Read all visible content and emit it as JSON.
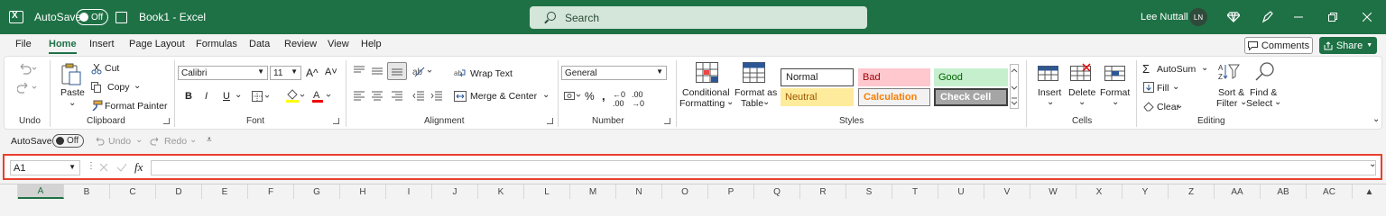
{
  "titlebar": {
    "autosave_label": "AutoSave",
    "autosave_state": "Off",
    "doc_title": "Book1  -  Excel",
    "search_placeholder": "Search",
    "user_name": "Lee Nuttall",
    "user_initials": "LN"
  },
  "tabs": [
    "File",
    "Home",
    "Insert",
    "Page Layout",
    "Formulas",
    "Data",
    "Review",
    "View",
    "Help"
  ],
  "active_tab": "Home",
  "comments_label": "Comments",
  "share_label": "Share",
  "ribbon": {
    "undo_group": "Undo",
    "clipboard": {
      "group": "Clipboard",
      "paste": "Paste",
      "cut": "Cut",
      "copy": "Copy",
      "format_painter": "Format Painter"
    },
    "font": {
      "group": "Font",
      "font_name": "Calibri",
      "font_size": "11",
      "bold": "B",
      "italic": "I",
      "underline": "U",
      "grow": "A^",
      "shrink": "A˅"
    },
    "alignment": {
      "group": "Alignment",
      "wrap_text": "Wrap Text",
      "merge_center": "Merge & Center"
    },
    "number": {
      "group": "Number",
      "format": "General"
    },
    "styles": {
      "group": "Styles",
      "conditional_formatting_1": "Conditional",
      "conditional_formatting_2": "Formatting",
      "format_as_table_1": "Format as",
      "format_as_table_2": "Table",
      "cells": [
        "Normal",
        "Bad",
        "Good",
        "Neutral",
        "Calculation",
        "Check Cell"
      ]
    },
    "cells": {
      "group": "Cells",
      "insert": "Insert",
      "delete": "Delete",
      "format": "Format"
    },
    "editing": {
      "group": "Editing",
      "autosum": "AutoSum",
      "fill": "Fill",
      "clear": "Clear",
      "sort_filter_1": "Sort &",
      "sort_filter_2": "Filter",
      "find_select_1": "Find &",
      "find_select_2": "Select"
    }
  },
  "qat": {
    "autosave_label": "AutoSave",
    "autosave_state": "Off",
    "undo": "Undo",
    "redo": "Redo"
  },
  "formula_bar": {
    "name_box": "A1",
    "fx": "fx",
    "value": ""
  },
  "columns": [
    "A",
    "B",
    "C",
    "D",
    "E",
    "F",
    "G",
    "H",
    "I",
    "J",
    "K",
    "L",
    "M",
    "N",
    "O",
    "P",
    "Q",
    "R",
    "S",
    "T",
    "U",
    "V",
    "W",
    "X",
    "Y",
    "Z",
    "AA",
    "AB",
    "AC"
  ],
  "colors": {
    "excel_green": "#1e7145",
    "highlight_red": "#e8402d",
    "bad_bg": "#ffc7ce",
    "good_bg": "#c6efce",
    "neutral_bg": "#ffeb9c"
  }
}
